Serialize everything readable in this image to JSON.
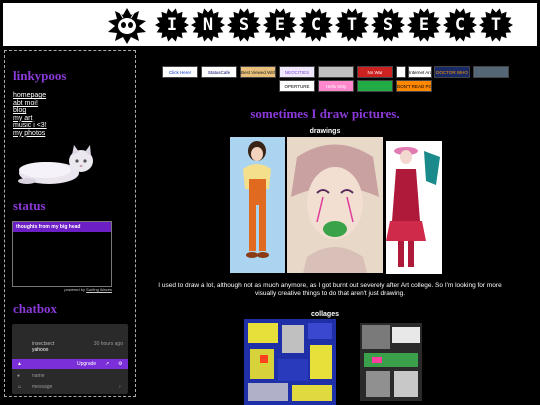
{
  "site": {
    "title_letters": [
      "I",
      "N",
      "S",
      "E",
      "C",
      "T",
      "S",
      "E",
      "C",
      "T"
    ]
  },
  "sidebar": {
    "heading": "linkypoos",
    "nav": [
      {
        "label": "homepage"
      },
      {
        "label": "abt moi!"
      },
      {
        "label": "blog"
      },
      {
        "label": "my art"
      },
      {
        "label": "music i <3!"
      },
      {
        "label": "my photos"
      }
    ],
    "status_heading": "status",
    "status_box_title": "thoughts from my big head",
    "powered_prefix": "powered by",
    "powered_link": "Surfing Waves",
    "chatbox_heading": "chatbox",
    "chat": {
      "author": "insectsect",
      "message": "yahooo",
      "time": "30 hours ago",
      "upgrade_label": "Upgrade",
      "name_placeholder": "name",
      "message_placeholder": "message"
    }
  },
  "buttons": [
    {
      "label": "Click Here!",
      "bg": "#ffffff",
      "fg": "#0033cc"
    },
    {
      "label": "StatusCafe",
      "bg": "#ffffff",
      "fg": "#000066"
    },
    {
      "label": "Best Viewed With Eyes",
      "bg": "#e8c07a",
      "fg": "#222222"
    },
    {
      "label": "NEOCITIES",
      "bg": "#f0e8ff",
      "fg": "#7a44cc"
    },
    {
      "label": "",
      "bg": "#c0c0c0",
      "fg": "#000000"
    },
    {
      "label": "No War",
      "bg": "#cc2222",
      "fg": "#ffffff"
    },
    {
      "label": "",
      "bg": "#ffffff",
      "fg": "#000000"
    },
    {
      "label": "Internet Archive",
      "bg": "#ffffff",
      "fg": "#000000"
    },
    {
      "label": "DOCTOR WHO",
      "bg": "#1a2a66",
      "fg": "#ff9900"
    },
    {
      "label": "",
      "bg": "#556677",
      "fg": "#ffffff"
    },
    {
      "label": "OPERTURE",
      "bg": "#ffffff",
      "fg": "#000000"
    },
    {
      "label": "Hello Kitty",
      "bg": "#ff88cc",
      "fg": "#ffffff"
    },
    {
      "label": "",
      "bg": "#22aa44",
      "fg": "#ffffff"
    },
    {
      "label": "DON'T READ POLL",
      "bg": "#ff8800",
      "fg": "#000000"
    }
  ],
  "main": {
    "title": "sometimes I draw pictures.",
    "drawings_heading": "drawings",
    "paragraph": "I used to draw a lot, although not as much anymore, as I got burnt out severely after Art college. So I'm looking for more visually creative things to do that aren't just drawing.",
    "collages_heading": "collages"
  },
  "colors": {
    "accent_purple": "#8b3ad9",
    "status_bar": "#6c1fc4",
    "chat_bar": "#7b2fd9"
  }
}
